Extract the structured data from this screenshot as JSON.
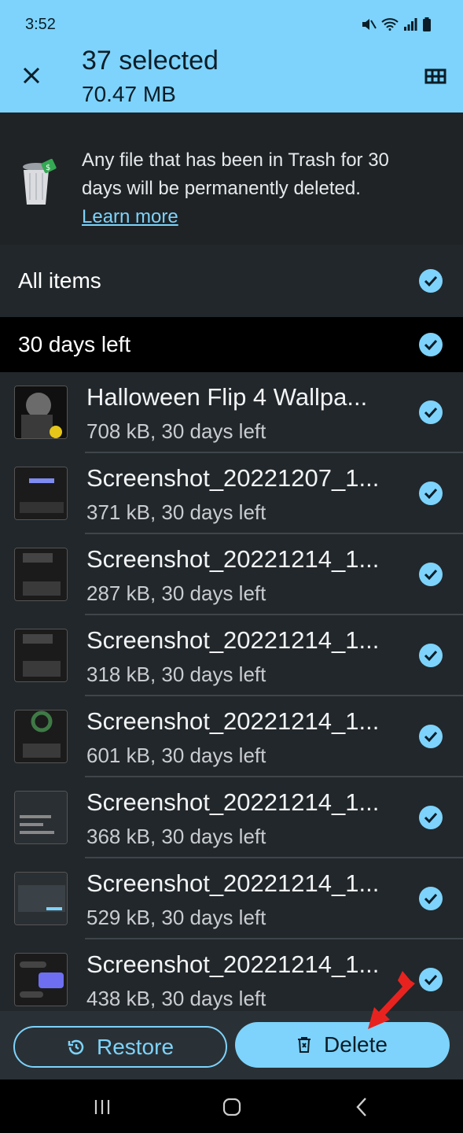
{
  "status_bar": {
    "time": "3:52"
  },
  "header": {
    "title": "37 selected",
    "subtitle": "70.47 MB"
  },
  "banner": {
    "text": "Any file that has been in Trash for 30 days will be permanently deleted.",
    "link": "Learn more"
  },
  "sections": {
    "all_items": "All items",
    "days_left": "30 days left"
  },
  "files": [
    {
      "name": "Halloween Flip 4 Wallpa...",
      "meta": "708 kB, 30 days left"
    },
    {
      "name": "Screenshot_20221207_1...",
      "meta": "371 kB, 30 days left"
    },
    {
      "name": "Screenshot_20221214_1...",
      "meta": "287 kB, 30 days left"
    },
    {
      "name": "Screenshot_20221214_1...",
      "meta": "318 kB, 30 days left"
    },
    {
      "name": "Screenshot_20221214_1...",
      "meta": "601 kB, 30 days left"
    },
    {
      "name": "Screenshot_20221214_1...",
      "meta": "368 kB, 30 days left"
    },
    {
      "name": "Screenshot_20221214_1...",
      "meta": "529 kB, 30 days left"
    },
    {
      "name": "Screenshot_20221214_1...",
      "meta": "438 kB, 30 days left"
    }
  ],
  "actions": {
    "restore": "Restore",
    "delete": "Delete"
  },
  "colors": {
    "accent": "#7dd3fb",
    "background": "#22272b",
    "annotation_arrow": "#e8231f"
  }
}
